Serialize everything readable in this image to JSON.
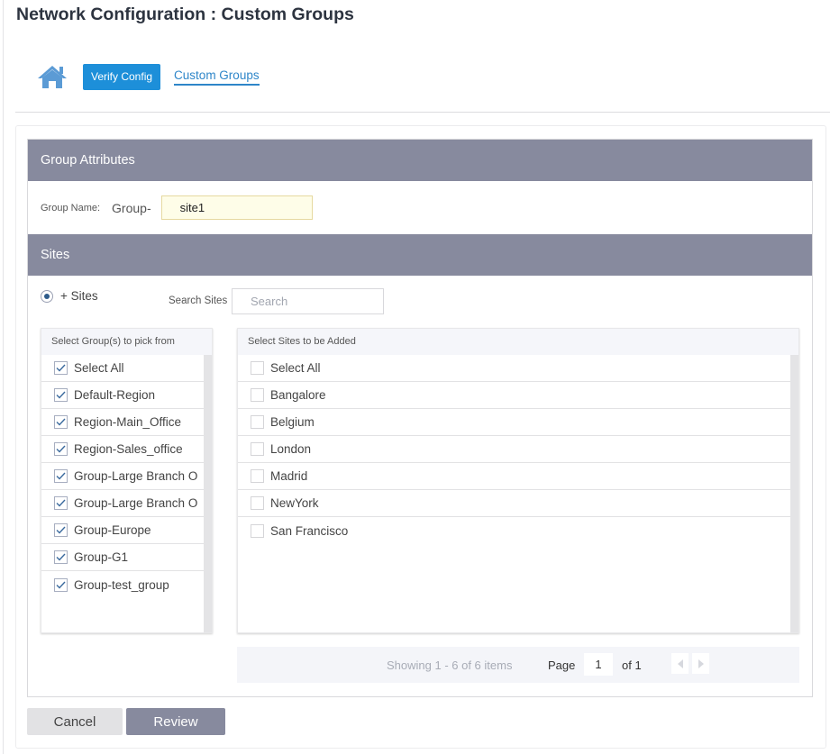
{
  "page": {
    "title": "Network Configuration : Custom Groups"
  },
  "nav": {
    "home_icon": "home-icon",
    "verify_label": "Verify Config",
    "breadcrumb_label": "Custom Groups"
  },
  "group_attributes": {
    "header": "Group Attributes",
    "name_label": "Group Name:",
    "name_prefix": "Group-",
    "name_value": "site1"
  },
  "sites": {
    "header": "Sites",
    "radio_label": "+ Sites",
    "radio_selected": true,
    "search_label": "Search Sites",
    "search_placeholder": "Search",
    "search_value": ""
  },
  "groups_list": {
    "header": "Select Group(s) to pick from",
    "items": [
      {
        "label": "Select All",
        "checked": true
      },
      {
        "label": "Default-Region",
        "checked": true
      },
      {
        "label": "Region-Main_Office",
        "checked": true
      },
      {
        "label": "Region-Sales_office",
        "checked": true
      },
      {
        "label": "Group-Large Branch O",
        "checked": true
      },
      {
        "label": "Group-Large Branch O",
        "checked": true
      },
      {
        "label": "Group-Europe",
        "checked": true
      },
      {
        "label": "Group-G1",
        "checked": true
      },
      {
        "label": "Group-test_group",
        "checked": true
      }
    ]
  },
  "sites_list": {
    "header": "Select Sites to be Added",
    "items": [
      {
        "label": "Select All",
        "checked": false
      },
      {
        "label": "Bangalore",
        "checked": false
      },
      {
        "label": "Belgium",
        "checked": false
      },
      {
        "label": "London",
        "checked": false
      },
      {
        "label": "Madrid",
        "checked": false
      },
      {
        "label": "NewYork",
        "checked": false
      },
      {
        "label": "San Francisco",
        "checked": false
      }
    ]
  },
  "pagination": {
    "showing": "Showing 1 - 6 of 6 items",
    "page_label": "Page",
    "page_value": "1",
    "of_label": "of 1"
  },
  "actions": {
    "cancel_label": "Cancel",
    "review_label": "Review"
  },
  "colors": {
    "accent": "#1d8fd9",
    "section_header": "#878a9e",
    "link": "#2e86c9",
    "input_highlight": "#fefde8"
  }
}
